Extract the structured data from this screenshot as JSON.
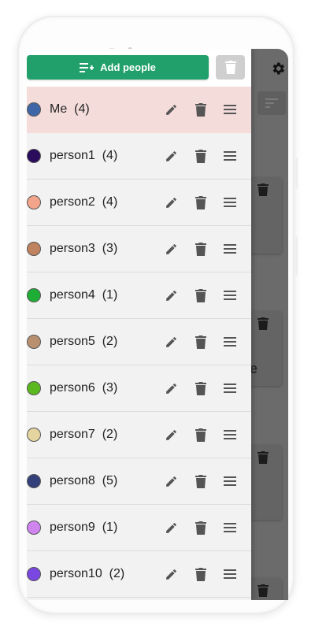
{
  "drawer": {
    "add_button_label": "Add people",
    "add_button_icon": "playlist-add-icon",
    "clear_button_icon": "trash-icon",
    "accent_color": "#22a06b"
  },
  "people": [
    {
      "name": "Me",
      "count": "(4)",
      "color": "#3f67a8",
      "selected": true
    },
    {
      "name": "person1",
      "count": "(4)",
      "color": "#2a0b5c"
    },
    {
      "name": "person2",
      "count": "(4)",
      "color": "#f2a58a"
    },
    {
      "name": "person3",
      "count": "(3)",
      "color": "#c0835f"
    },
    {
      "name": "person4",
      "count": "(1)",
      "color": "#1fae35"
    },
    {
      "name": "person5",
      "count": "(2)",
      "color": "#b89070"
    },
    {
      "name": "person6",
      "count": "(3)",
      "color": "#5cb81f"
    },
    {
      "name": "person7",
      "count": "(2)",
      "color": "#e3d4a0"
    },
    {
      "name": "person8",
      "count": "(5)",
      "color": "#34407a"
    },
    {
      "name": "person9",
      "count": "(1)",
      "color": "#cf84f0"
    },
    {
      "name": "person10",
      "count": "(2)",
      "color": "#7a47e0"
    }
  ],
  "background": {
    "settings_icon": "gear-icon",
    "sort_icon": "sort-icon",
    "partial_text": "e"
  }
}
